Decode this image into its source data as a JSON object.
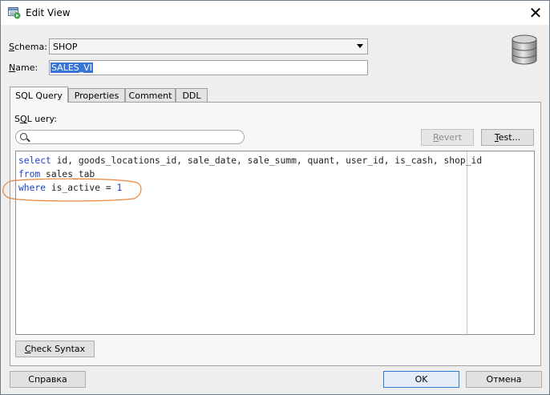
{
  "window": {
    "title": "Edit View"
  },
  "form": {
    "schema_label_u": "S",
    "schema_label_rest": "chema:",
    "schema_value": "SHOP",
    "name_label_u": "N",
    "name_label_rest": "ame:",
    "name_value": "SALES_VI"
  },
  "tabs": [
    {
      "label": "SQL Query",
      "active": true
    },
    {
      "label": "Properties",
      "active": false
    },
    {
      "label": "Comment",
      "active": false
    },
    {
      "label": "DDL",
      "active": false
    }
  ],
  "sql_panel": {
    "label_u": "Q",
    "label_pre": "S",
    "label_mid": "L ",
    "label_post": "uery:",
    "search_placeholder": "",
    "revert_u": "R",
    "revert_rest": "evert",
    "test_u": "T",
    "test_rest": "est...",
    "check_u": "C",
    "check_rest": "heck Syntax"
  },
  "code": {
    "line1_kw": "select",
    "line1_rest": " id, goods_locations_id, sale_date, sale_summ, quant, user_id, is_cash, shop_id",
    "line2_kw": "from",
    "line2_rest": " sales_tab",
    "line3_kw": "where",
    "line3_rest": " is_active = ",
    "line3_num": "1"
  },
  "footer": {
    "help_label": "Справка",
    "ok_label": "OK",
    "cancel_label": "Отмена"
  },
  "colors": {
    "keyword": "#1c3fc9",
    "annotation": "#e8863a",
    "selection": "#3875d7"
  },
  "icons": {
    "app": "edit-view-icon",
    "database": "database-icon",
    "search": "search-icon",
    "close": "close-icon"
  }
}
